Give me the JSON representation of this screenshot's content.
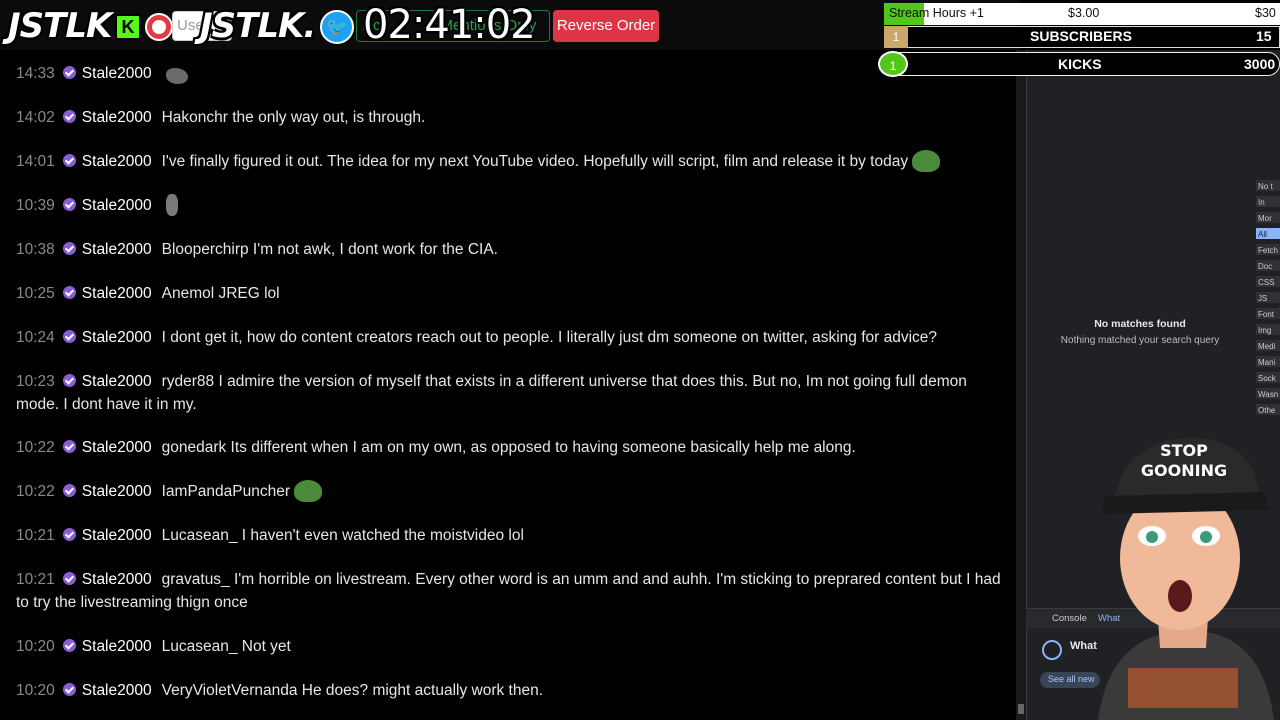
{
  "toolbar": {
    "logo": "JSTLK",
    "logo2": "JSTLK.",
    "k_badge": "K",
    "user_placeholder": "User",
    "green_button_left": "Ac",
    "green_button_right": "Mentions Only",
    "timer": "02:41:02",
    "reverse_order": "Reverse Order"
  },
  "overlay": {
    "stream_hours_label": "Stream Hours +1",
    "stream_hours_value1": "$3.00",
    "stream_hours_value2": "$30",
    "subscribers_num": "1",
    "subscribers_label": "SUBSCRIBERS",
    "subscribers_value": "15",
    "kicks_num": "1",
    "kicks_label": "KICKS",
    "kicks_value": "3000"
  },
  "devtools": {
    "no_matches_title": "No matches found",
    "no_matches_sub": "Nothing matched your search query",
    "filters": [
      "No t",
      "In",
      "Mor",
      "All",
      "Fetch",
      "Doc",
      "CSS",
      "JS",
      "Font",
      "Img",
      "Medi",
      "Mani",
      "Sock",
      "Wasn",
      "Othe"
    ],
    "tab_console": "Console",
    "tab_whats": "What",
    "whats_new": "What",
    "see_all": "See all new"
  },
  "messages": [
    {
      "time": "14:33",
      "user": "Stale2000",
      "text": "",
      "emote": "rock"
    },
    {
      "time": "14:02",
      "user": "Stale2000",
      "text": "Hakonchr the only way out, is through.",
      "emote": ""
    },
    {
      "time": "14:01",
      "user": "Stale2000",
      "text": "I've finally figured it out. The idea for my next YouTube video. Hopefully will script, film and release it by today",
      "emote": "pepe"
    },
    {
      "time": "10:39",
      "user": "Stale2000",
      "text": "",
      "emote": "fig"
    },
    {
      "time": "10:38",
      "user": "Stale2000",
      "text": "Blooperchirp I'm not awk, I dont work for the CIA.",
      "emote": ""
    },
    {
      "time": "10:25",
      "user": "Stale2000",
      "text": "Anemol JREG lol",
      "emote": ""
    },
    {
      "time": "10:24",
      "user": "Stale2000",
      "text": "I dont get it, how do content creators reach out to people. I literally just dm someone on twitter, asking for advice?",
      "emote": ""
    },
    {
      "time": "10:23",
      "user": "Stale2000",
      "text": "ryder88 I admire the version of myself that exists in a different universe that does this. But no, Im not going full demon mode. I dont have it in my.",
      "emote": ""
    },
    {
      "time": "10:22",
      "user": "Stale2000",
      "text": "gonedark Its different when I am on my own, as opposed to having someone basically help me along.",
      "emote": ""
    },
    {
      "time": "10:22",
      "user": "Stale2000",
      "text": "IamPandaPuncher",
      "emote": "pepe"
    },
    {
      "time": "10:21",
      "user": "Stale2000",
      "text": "Lucasean_ I haven't even watched the moistvideo lol",
      "emote": ""
    },
    {
      "time": "10:21",
      "user": "Stale2000",
      "text": "gravatus_ I'm horrible on livestream. Every other word is an umm and and auhh. I'm sticking to preprared content but I had to try the livestreaming thign once",
      "emote": ""
    },
    {
      "time": "10:20",
      "user": "Stale2000",
      "text": "Lucasean_ Not yet",
      "emote": ""
    },
    {
      "time": "10:20",
      "user": "Stale2000",
      "text": "VeryVioletVernanda He does? might actually work then.",
      "emote": ""
    }
  ],
  "avatar_cap": {
    "line1": "STOP",
    "line2": "GOONING"
  }
}
